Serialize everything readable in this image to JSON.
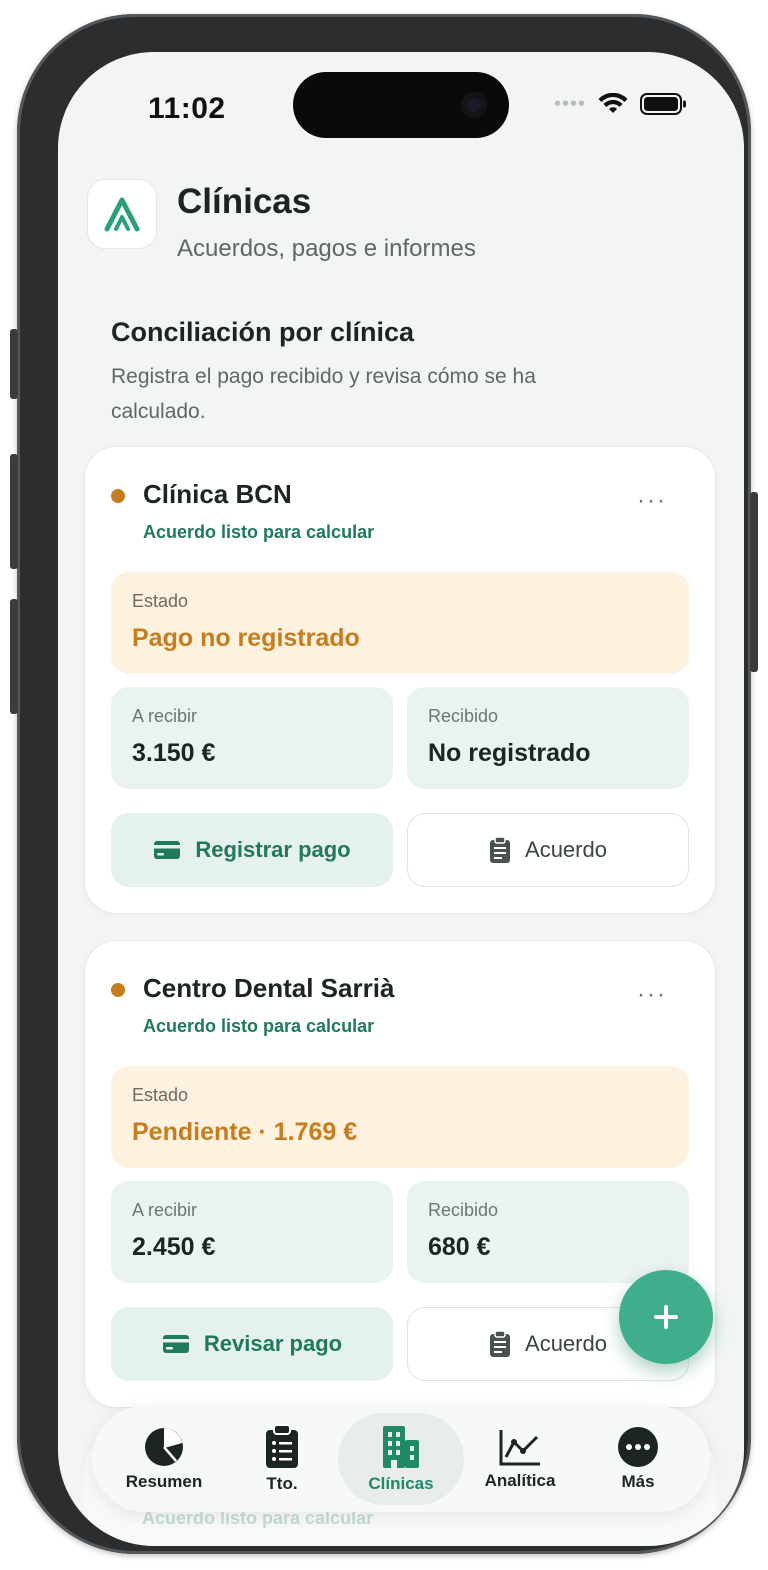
{
  "status_bar": {
    "time": "11:02"
  },
  "header": {
    "title": "Clínicas",
    "subtitle": "Acuerdos, pagos e informes",
    "logo_icon": "app-logo-icon"
  },
  "section": {
    "title": "Conciliación por clínica",
    "description": "Registra el pago recibido y revisa cómo se ha calculado."
  },
  "clinics": [
    {
      "name": "Clínica BCN",
      "agreement_status": "Acuerdo listo para calcular",
      "state_label": "Estado",
      "state_value": "Pago no registrado",
      "to_receive_label": "A recibir",
      "to_receive_value": "3.150 €",
      "received_label": "Recibido",
      "received_value": "No registrado",
      "primary_button": "Registrar pago",
      "secondary_button": "Acuerdo",
      "more": "···"
    },
    {
      "name": "Centro Dental Sarrià",
      "agreement_status": "Acuerdo listo para calcular",
      "state_label": "Estado",
      "state_value": "Pendiente · 1.769 €",
      "to_receive_label": "A recibir",
      "to_receive_value": "2.450 €",
      "received_label": "Recibido",
      "received_value": "680 €",
      "primary_button": "Revisar pago",
      "secondary_button": "Acuerdo",
      "more": "···"
    },
    {
      "agreement_status": "Acuerdo listo para calcular"
    }
  ],
  "fab": {
    "icon": "plus-icon"
  },
  "tabbar": {
    "tabs": [
      {
        "label": "Resumen",
        "icon": "pie-chart-icon"
      },
      {
        "label": "Tto.",
        "icon": "clipboard-list-icon"
      },
      {
        "label": "Clínicas",
        "icon": "building-icon",
        "active": true
      },
      {
        "label": "Analítica",
        "icon": "line-chart-icon"
      },
      {
        "label": "Más",
        "icon": "more-circle-icon"
      }
    ]
  },
  "colors": {
    "accent": "#1f7a59",
    "warning": "#c77d1c",
    "fab": "#3fae8c",
    "background": "#f3f5f4"
  }
}
